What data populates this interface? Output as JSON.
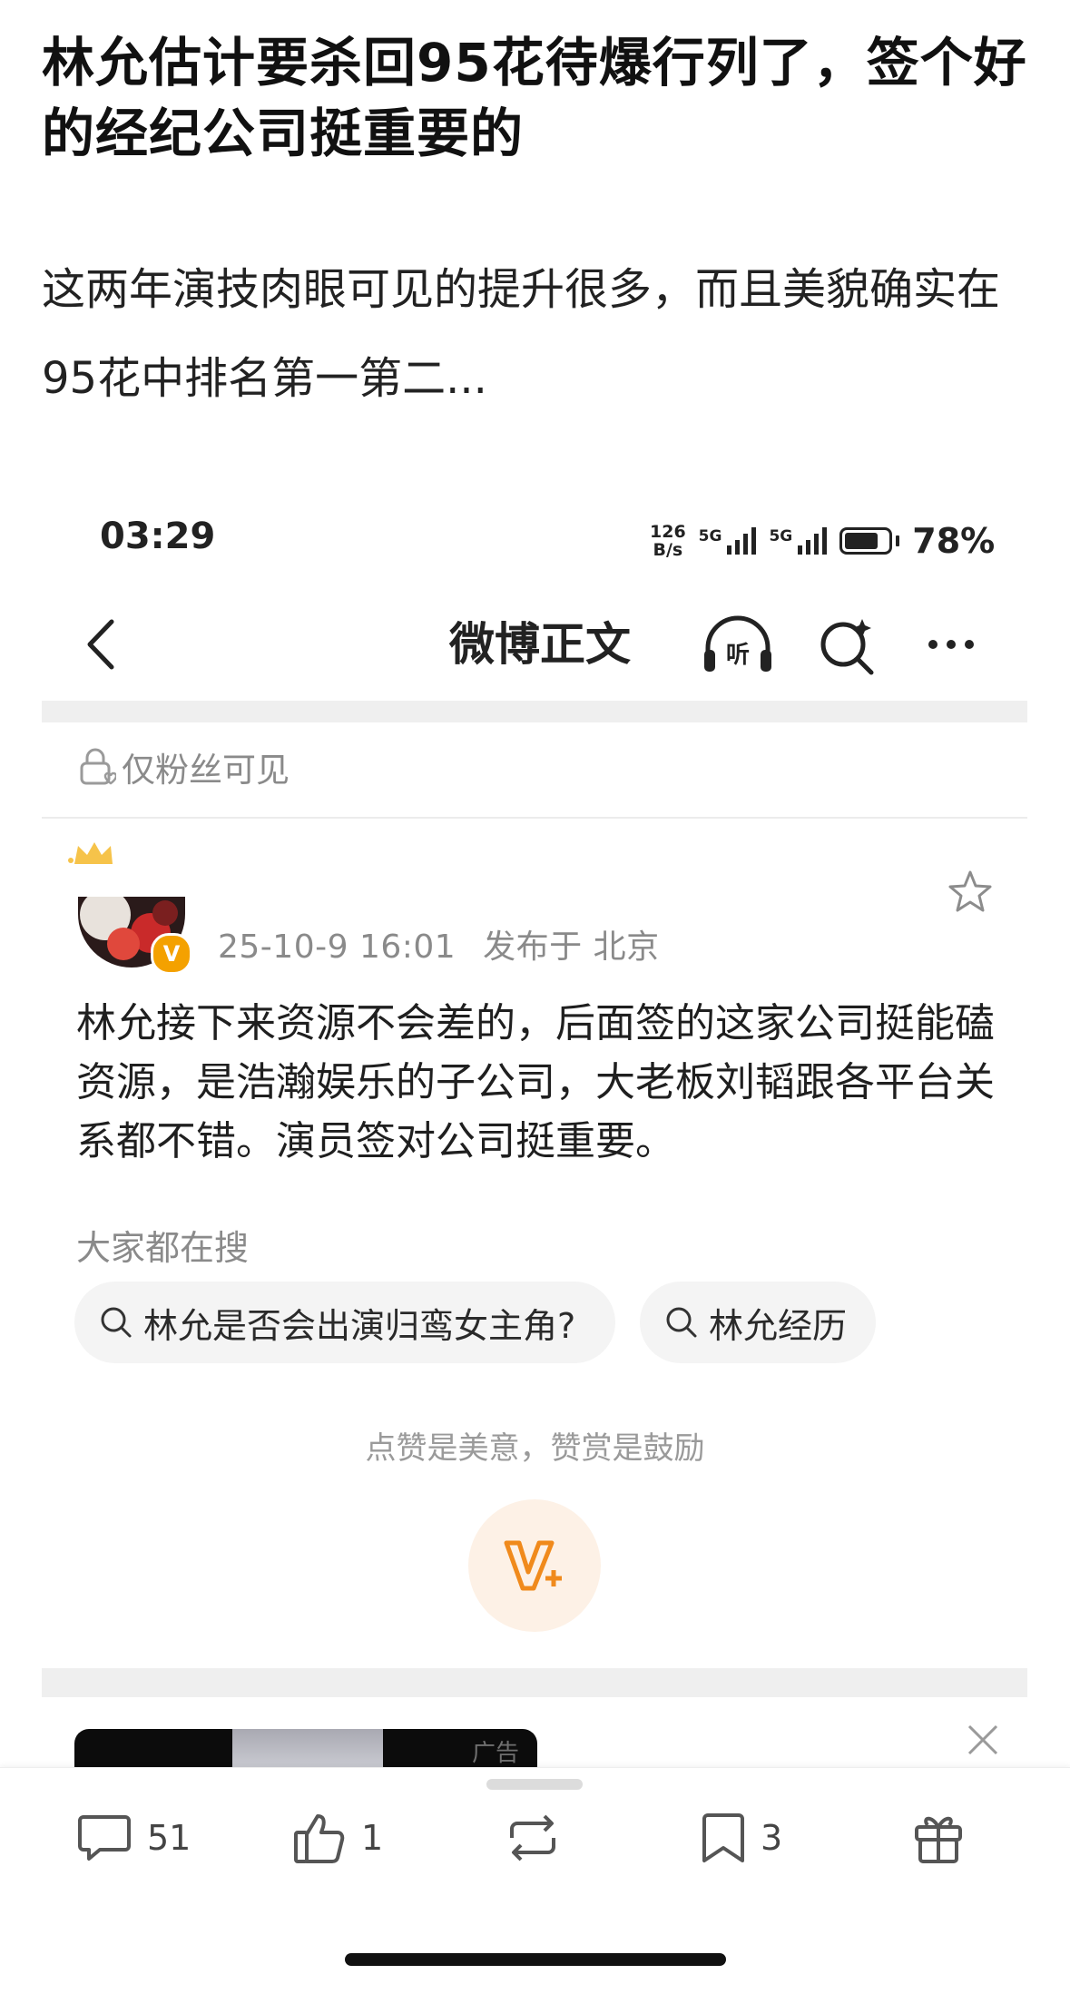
{
  "article": {
    "headline": "林允估计要杀回95花待爆行列了，签个好的经纪公司挺重要的",
    "summary": "这两年演技肉眼可见的提升很多，而且美貌确实在95花中排名第一第二..."
  },
  "status_bar": {
    "time": "03:29",
    "net_speed_value": "126",
    "net_speed_unit": "B/s",
    "signal_1_label": "5G",
    "signal_2_label": "5G",
    "battery_level": 0.78,
    "battery_text": "78%"
  },
  "nav": {
    "title": "微博正文",
    "listen_label": "听"
  },
  "post": {
    "visibility": "仅粉丝可见",
    "verified_badge": "V",
    "timestamp": "25-10-9 16:01",
    "location": "发布于 北京",
    "body": "林允接下来资源不会差的，后面签的这家公司挺能磕资源，是浩瀚娱乐的子公司，大老板刘韬跟各平台关系都不错。演员签对公司挺重要。"
  },
  "search": {
    "title": "大家都在搜",
    "chips": [
      "林允是否会出演归鸾女主角?",
      "林允经历"
    ]
  },
  "reward": {
    "text": "点赞是美意，赞赏是鼓励"
  },
  "ad": {
    "label": "广告"
  },
  "toolbar": {
    "comments": "51",
    "likes": "1",
    "favorites": "3"
  },
  "colors": {
    "accent_orange": "#f4a100",
    "reward_bg": "#fdf1e6"
  }
}
